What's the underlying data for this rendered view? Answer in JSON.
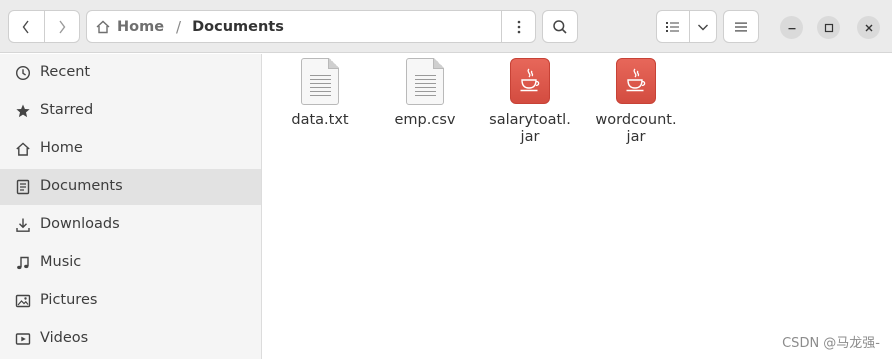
{
  "header": {
    "back_icon": "chevron-left-icon",
    "forward_icon": "chevron-right-icon",
    "path": {
      "home_label": "Home",
      "separator": "/",
      "current": "Documents"
    },
    "path_menu_icon": "vertical-dots-icon",
    "search_icon": "search-icon",
    "view_icon": "list-view-icon",
    "view_dropdown_icon": "chevron-down-icon",
    "main_menu_icon": "hamburger-icon",
    "window_controls": [
      "minimize-icon",
      "maximize-icon",
      "close-icon"
    ]
  },
  "sidebar": {
    "items": [
      {
        "label": "Recent",
        "icon": "clock-icon",
        "active": false
      },
      {
        "label": "Starred",
        "icon": "star-icon",
        "active": false
      },
      {
        "label": "Home",
        "icon": "home-icon",
        "active": false
      },
      {
        "label": "Documents",
        "icon": "document-icon",
        "active": true
      },
      {
        "label": "Downloads",
        "icon": "download-icon",
        "active": false
      },
      {
        "label": "Music",
        "icon": "music-note-icon",
        "active": false
      },
      {
        "label": "Pictures",
        "icon": "image-icon",
        "active": false
      },
      {
        "label": "Videos",
        "icon": "video-icon",
        "active": false
      }
    ]
  },
  "files": [
    {
      "name_line1": "data.txt",
      "name_line2": "",
      "type": "text"
    },
    {
      "name_line1": "emp.csv",
      "name_line2": "",
      "type": "text"
    },
    {
      "name_line1": "salarytoatl.",
      "name_line2": "jar",
      "type": "java-archive"
    },
    {
      "name_line1": "wordcount.",
      "name_line2": "jar",
      "type": "java-archive"
    }
  ],
  "watermark": "CSDN @马龙强-",
  "colors": {
    "headerbar": "#ebebeb",
    "sidebar": "#f5f5f5",
    "sidebar_active": "#e2e2e2",
    "jar_icon": "#e25a4d"
  }
}
